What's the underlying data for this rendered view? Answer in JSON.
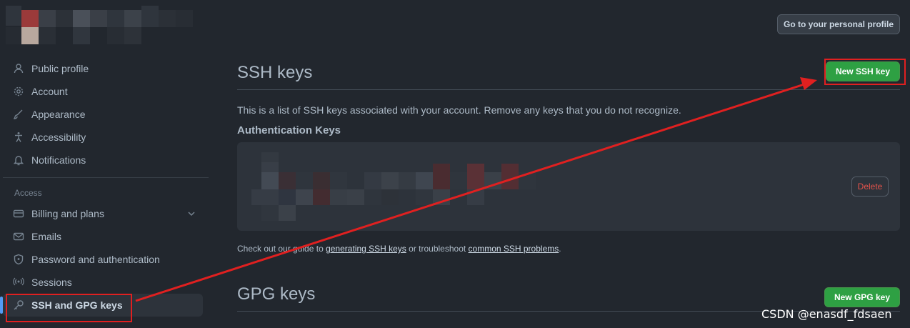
{
  "header": {
    "profile_button": "Go to your personal profile"
  },
  "sidebar": {
    "items": [
      {
        "label": "Public profile",
        "icon": "person-icon"
      },
      {
        "label": "Account",
        "icon": "gear-icon"
      },
      {
        "label": "Appearance",
        "icon": "paintbrush-icon"
      },
      {
        "label": "Accessibility",
        "icon": "accessibility-icon"
      },
      {
        "label": "Notifications",
        "icon": "bell-icon"
      }
    ],
    "access_title": "Access",
    "access_items": [
      {
        "label": "Billing and plans",
        "icon": "credit-card-icon"
      },
      {
        "label": "Emails",
        "icon": "mail-icon"
      },
      {
        "label": "Password and authentication",
        "icon": "shield-lock-icon"
      },
      {
        "label": "Sessions",
        "icon": "broadcast-icon"
      },
      {
        "label": "SSH and GPG keys",
        "icon": "key-icon"
      }
    ]
  },
  "ssh": {
    "title": "SSH keys",
    "new_button": "New SSH key",
    "description": "This is a list of SSH keys associated with your account. Remove any keys that you do not recognize.",
    "auth_heading": "Authentication Keys",
    "delete_button": "Delete",
    "help_prefix": "Check out our guide to ",
    "help_link1": "generating SSH keys",
    "help_middle": " or troubleshoot ",
    "help_link2": "common SSH problems",
    "help_suffix": "."
  },
  "gpg": {
    "title": "GPG keys",
    "new_button": "New GPG key"
  },
  "watermark": "CSDN @enasdf_fdsaen",
  "colors": {
    "accent_green": "#2ea043",
    "danger": "#e5534b",
    "annotation_red": "#e02020",
    "bg": "#22272e"
  }
}
